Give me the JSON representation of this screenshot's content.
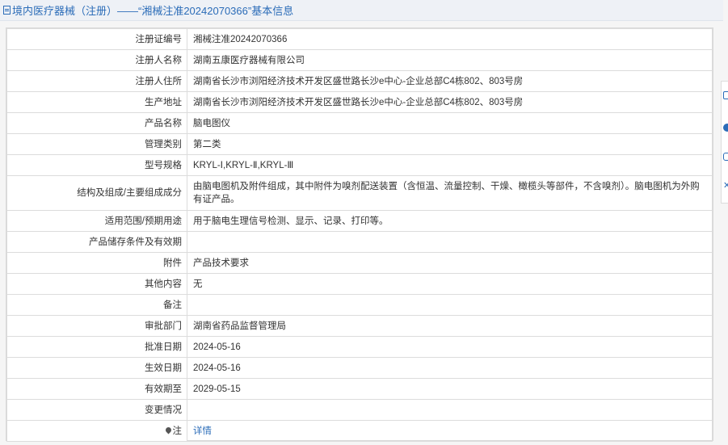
{
  "header": {
    "icon": "document-icon",
    "title": "境内医疗器械（注册）——“湘械注准20242070366”基本信息"
  },
  "rows": [
    {
      "label": "注册证编号",
      "value": "湘械注准20242070366"
    },
    {
      "label": "注册人名称",
      "value": "湖南五康医疗器械有限公司"
    },
    {
      "label": "注册人住所",
      "value": "湖南省长沙市浏阳经济技术开发区盛世路长沙e中心-企业总部C4栋802、803号房"
    },
    {
      "label": "生产地址",
      "value": "湖南省长沙市浏阳经济技术开发区盛世路长沙e中心-企业总部C4栋802、803号房"
    },
    {
      "label": "产品名称",
      "value": "脑电图仪"
    },
    {
      "label": "管理类别",
      "value": "第二类"
    },
    {
      "label": "型号规格",
      "value": "KRYL-Ⅰ,KRYL-Ⅱ,KRYL-Ⅲ"
    },
    {
      "label": "结构及组成/主要组成成分",
      "value": "由脑电图机及附件组成，其中附件为嗅剂配送装置（含恒温、流量控制、干燥、橄榄头等部件，不含嗅剂）。脑电图机为外购有证产品。"
    },
    {
      "label": "适用范围/预期用途",
      "value": "用于脑电生理信号检测、显示、记录、打印等。"
    },
    {
      "label": "产品储存条件及有效期",
      "value": ""
    },
    {
      "label": "附件",
      "value": "产品技术要求"
    },
    {
      "label": "其他内容",
      "value": "无"
    },
    {
      "label": "备注",
      "value": ""
    },
    {
      "label": "审批部门",
      "value": "湖南省药品监督管理局"
    },
    {
      "label": "批准日期",
      "value": "2024-05-16"
    },
    {
      "label": "生效日期",
      "value": "2024-05-16"
    },
    {
      "label": "有效期至",
      "value": "2029-05-15"
    },
    {
      "label": "变更情况",
      "value": ""
    },
    {
      "label": "注",
      "value": "详情"
    }
  ],
  "side_tools": [
    "document-icon",
    "info-icon",
    "copy-icon",
    "close-icon"
  ],
  "colors": {
    "accent": "#2b6cb8",
    "border": "#dcdcdc"
  }
}
